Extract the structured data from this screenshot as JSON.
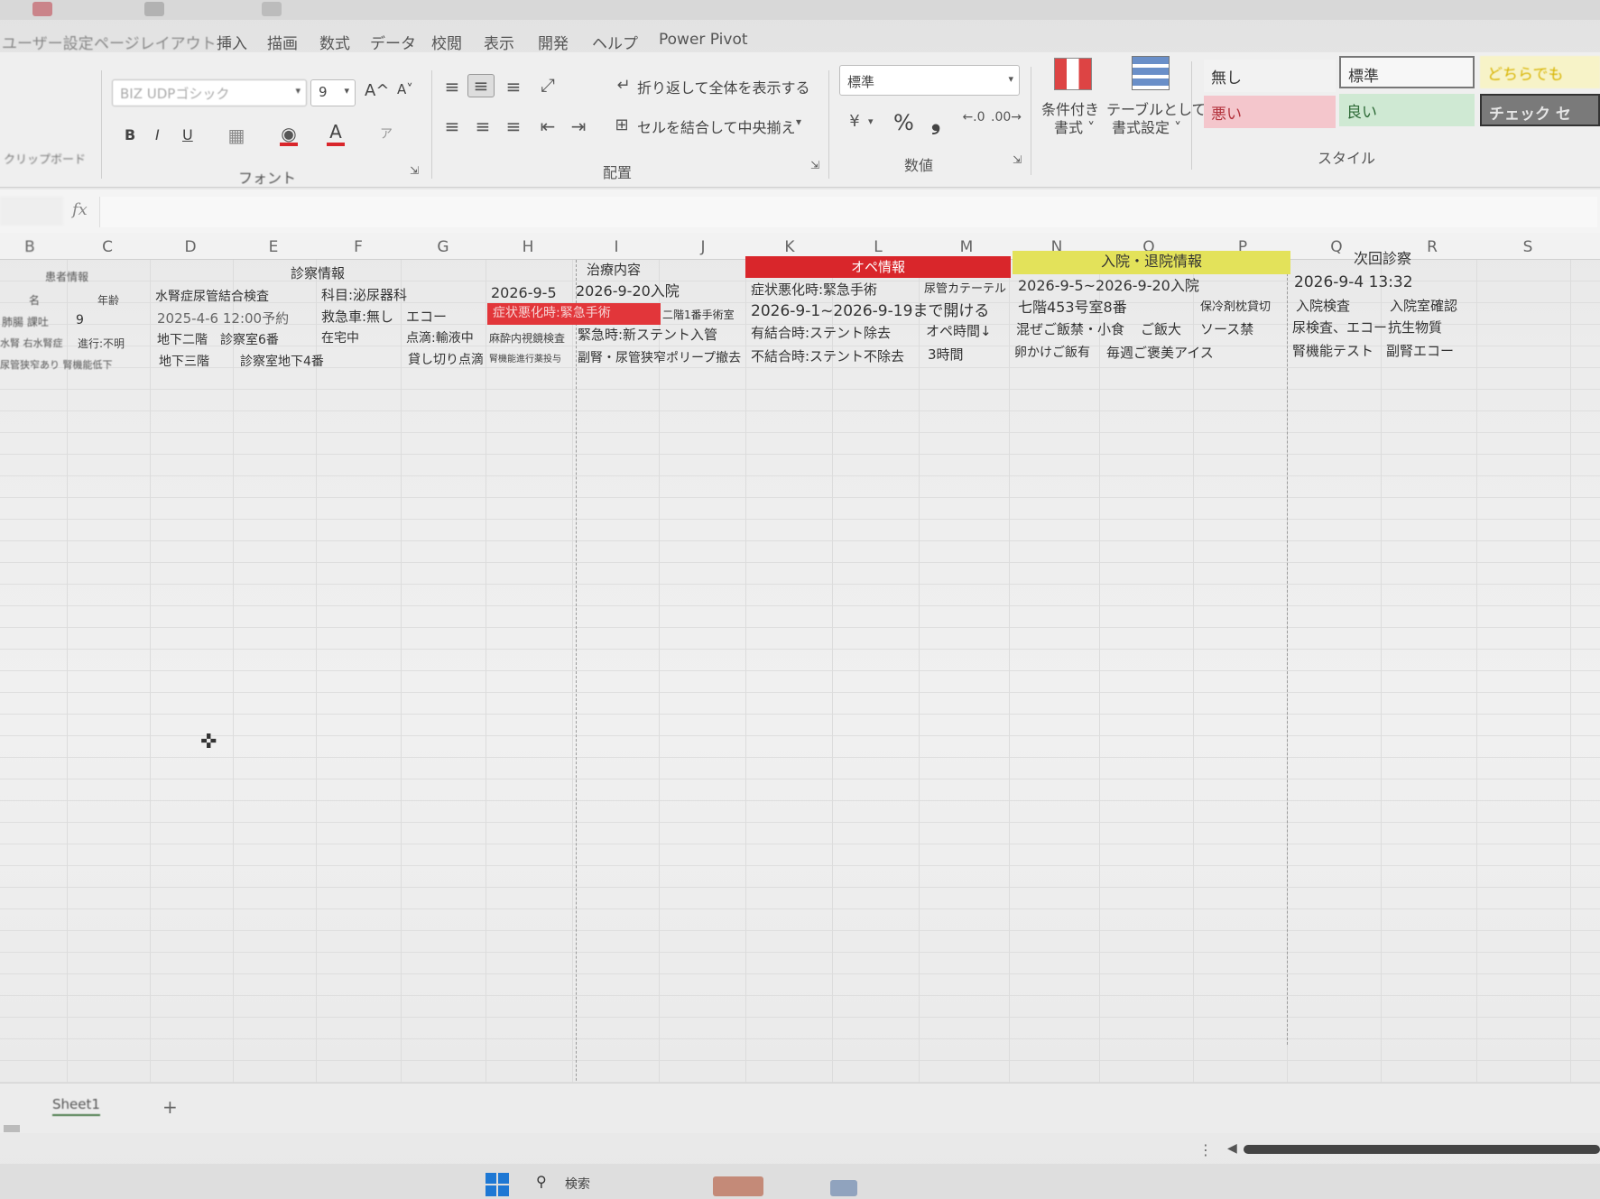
{
  "menu": {
    "tabs": [
      "ユーザー設定",
      "ページレイアウト",
      "挿入",
      "描画",
      "数式",
      "データ",
      "校閲",
      "表示",
      "開発",
      "ヘルプ",
      "Power Pivot"
    ]
  },
  "ribbon": {
    "font_name": "BIZ UDPゴシック",
    "font_size": "9",
    "grow_font": "A^",
    "shrink_font": "A˅",
    "bold": "B",
    "italic": "I",
    "underline": "U",
    "font_group_label": "フォント",
    "wrap_text": "折り返して全体を表示する",
    "merge_center": "セルを結合して中央揃え",
    "alignment_group_label": "配置",
    "number_format": "標準",
    "percent": "%",
    "comma": "❟",
    "number_group_label": "数値",
    "conditional_format": "条件付き\n書式",
    "conditional_format_l1": "条件付き",
    "conditional_format_l2": "書式 ˅",
    "format_as_table_l1": "テーブルとして",
    "format_as_table_l2": "書式設定 ˅",
    "styles": {
      "none": "無し",
      "standard": "標準",
      "bad": "悪い",
      "good": "良い",
      "neutral": "どちらでも",
      "check": "チェック セ"
    },
    "styles_group_label": "スタイル",
    "clipboard_label": "クリップボード",
    "accent_red": "#d9262b",
    "accent_yellow": "#e3e25a"
  },
  "formula": {
    "fx": "fx",
    "name_box": ""
  },
  "columns": [
    "B",
    "C",
    "D",
    "E",
    "F",
    "G",
    "H",
    "I",
    "J",
    "K",
    "L",
    "M",
    "N",
    "O",
    "P",
    "Q",
    "R",
    "S"
  ],
  "sections": {
    "patient_info": "患者情報",
    "diagnosis_info": "診察情報",
    "treatment": "治療内容",
    "surgery_info": "オペ情報",
    "admission_info": "入院・退院情報",
    "next_visit": "次回診察"
  },
  "cells": {
    "r1": {
      "b": "名",
      "c": "年齢",
      "d": "水腎症尿管結合検査",
      "f": "科目:泌尿器科",
      "h": "2026-9-5",
      "i": "2026-9-20入院",
      "k": "症状悪化時:緊急手術",
      "m": "尿管カテーテル",
      "n": "2026-9-5~2026-9-20入院",
      "q": "2026-9-4 13:32"
    },
    "r2": {
      "b": "肺腸 課吐",
      "c": "9",
      "d": "2025-4-6 12:00予約",
      "f": "救急車:無し",
      "g": "エコー",
      "h": "症状悪化時:緊急手術",
      "j": "二階1番手術室",
      "k": "2026-9-1~2026-9-19まで開ける",
      "n": "七階453号室8番",
      "p": "保冷剤枕貸切",
      "q": "入院検査",
      "r": "入院室確認"
    },
    "r3": {
      "b": "水腎 右水腎症",
      "c": "進行:不明",
      "d": "地下二階",
      "e": "診察室6番",
      "f": "在宅中",
      "g": "点滴:輸液中",
      "h": "麻酔内視鏡検査",
      "i": "緊急時:新ステント入管",
      "k": "有結合時:ステント除去",
      "m": "オペ時間↓",
      "n": "混ぜご飯禁・小食",
      "o": "ご飯大",
      "p": "ソース禁",
      "q": "尿検査、エコー",
      "r": "抗生物質"
    },
    "r4": {
      "b": "尿管狭窄あり 腎機能低下",
      "d": "地下三階",
      "e": "診察室地下4番",
      "g": "貸し切り点滴",
      "h": "腎機能進行薬投与",
      "i": "副腎・尿管狭窄ポリープ撤去",
      "k": "不結合時:ステント不除去",
      "m": "3時間",
      "n": "卵かけご飯有",
      "o": "毎週ご褒美アイス",
      "q": "腎機能テスト",
      "r": "副腎エコー"
    }
  },
  "sheet_tabs": {
    "active": "Sheet1",
    "add": "+"
  },
  "taskbar": {
    "search": "検索"
  }
}
